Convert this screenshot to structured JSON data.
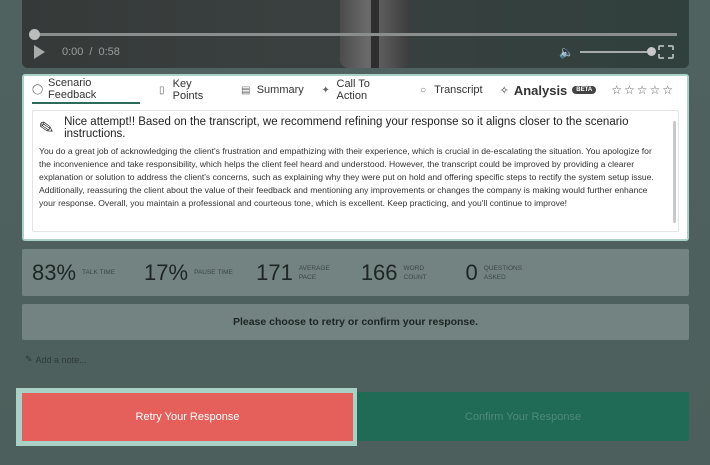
{
  "video": {
    "current_time": "0:00",
    "separator": "/",
    "duration": "0:58",
    "progress": 0
  },
  "tabs": [
    {
      "label": "Scenario Feedback",
      "icon": "lightbulb-icon"
    },
    {
      "label": "Key Points",
      "icon": "bookmark-icon"
    },
    {
      "label": "Summary",
      "icon": "document-icon"
    },
    {
      "label": "Call To Action",
      "icon": "sparkle-icon"
    },
    {
      "label": "Transcript",
      "icon": "chat-icon"
    }
  ],
  "analysis": {
    "label": "Analysis",
    "badge": "BETA",
    "rating": 0,
    "max_rating": 5
  },
  "feedback": {
    "title": "Nice attempt!! Based on the transcript, we recommend refining your response so it aligns closer to the scenario instructions.",
    "body": "You do a great job of acknowledging the client's frustration and empathizing with their experience, which is crucial in de-escalating the situation. You apologize for the inconvenience and take responsibility, which helps the client feel heard and understood. However, the transcript could be improved by providing a clearer explanation or solution to address the client's concerns, such as explaining why they were put on hold and offering specific steps to rectify the system setup issue. Additionally, reassuring the client about the value of their feedback and mentioning any improvements or changes the company is making would further enhance your response. Overall, you maintain a professional and courteous tone, which is excellent. Keep practicing, and you'll continue to improve!"
  },
  "stats": [
    {
      "value": "83%",
      "label": "TALK TIME"
    },
    {
      "value": "17%",
      "label": "PAUSE TIME"
    },
    {
      "value": "171",
      "label": "AVERAGE PACE"
    },
    {
      "value": "166",
      "label": "WORD COUNT"
    },
    {
      "value": "0",
      "label": "QUESTIONS ASKED"
    }
  ],
  "prompt": "Please choose to retry or confirm your response.",
  "note_link": "Add a note...",
  "buttons": {
    "retry": "Retry Your Response",
    "confirm": "Confirm Your Response"
  },
  "colors": {
    "retry": "#e5605b",
    "confirm": "#1f6b55",
    "highlight": "#a9d1c6"
  }
}
